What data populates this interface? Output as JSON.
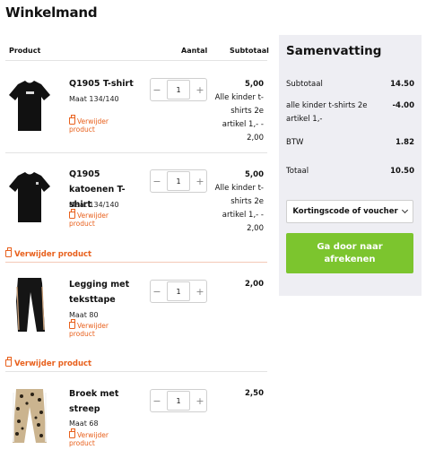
{
  "page": {
    "title": "Winkelmand"
  },
  "table": {
    "col_product": "Product",
    "col_quantity": "Aantal",
    "col_subtotal": "Subtotaal"
  },
  "items": [
    {
      "name": "Q1905 T-shirt",
      "size": "Maat 134/140",
      "remove": "Verwijder product",
      "quantity": "1",
      "price": "5,00",
      "discount_text": "Alle kinder t-shirts 2e artikel 1,- -",
      "discount_value": "2,00",
      "image_icon": "black-tshirt-image"
    },
    {
      "name": "Q1905 katoenen T-shirt",
      "size": "Maat 134/140",
      "remove": "Verwijder product",
      "quantity": "1",
      "price": "5,00",
      "discount_text": "Alle kinder t-shirts 2e artikel 1,- -",
      "discount_value": "2,00",
      "image_icon": "black-tshirt-image"
    },
    {
      "name": "Legging met teksttape",
      "size": "Maat 80",
      "remove": "Verwijder product",
      "quantity": "1",
      "price": "2,00",
      "image_icon": "black-legging-image"
    },
    {
      "name": "Broek met streep",
      "size": "Maat 68",
      "remove": "Verwijder product",
      "quantity": "1",
      "price": "2,50",
      "image_icon": "leopard-pants-image"
    }
  ],
  "group_remove_label": "Verwijder product",
  "stepper": {
    "minus": "−",
    "plus": "+"
  },
  "summary": {
    "title": "Samenvatting",
    "subtotal_label": "Subtotaal",
    "subtotal_value": "14.50",
    "discount_label": "alle kinder t-shirts 2e artikel 1,-",
    "discount_value": "-4.00",
    "vat_label": "BTW",
    "vat_value": "1.82",
    "total_label": "Totaal",
    "total_value": "10.50",
    "coupon_label": "Kortingscode of voucher",
    "checkout_label": "Ga door naar afrekenen"
  },
  "colors": {
    "accent_orange": "#e8601c",
    "checkout_green": "#7cc52e",
    "summary_bg": "#eeeef3"
  }
}
